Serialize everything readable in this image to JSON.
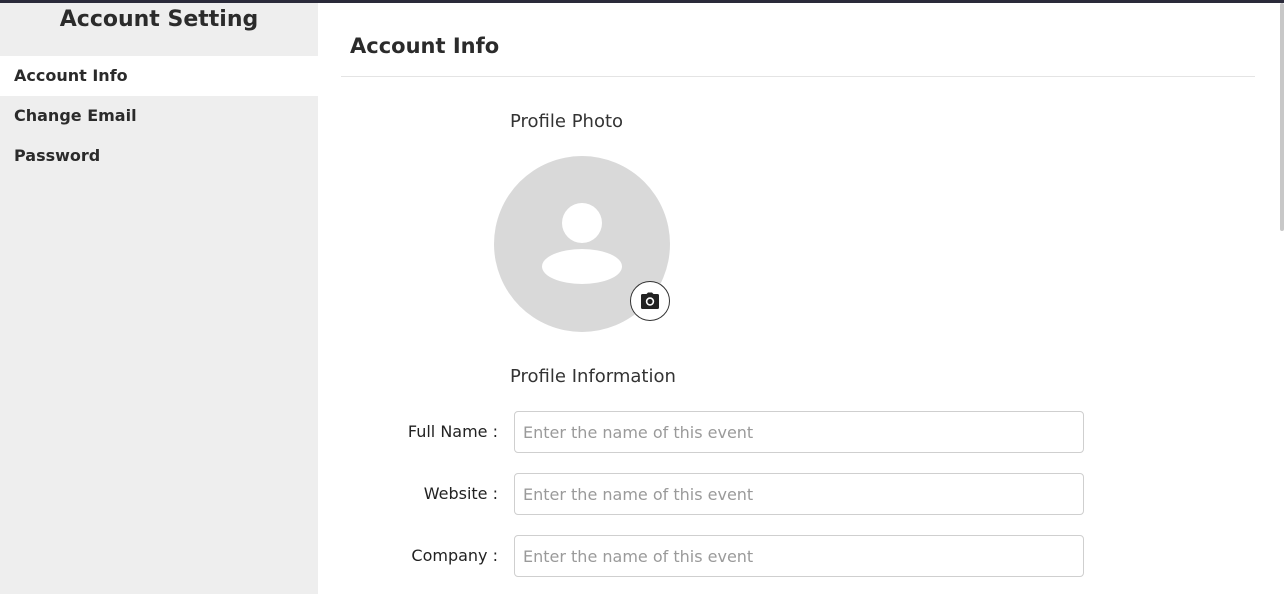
{
  "sidebar": {
    "title": "Account Setting",
    "items": [
      {
        "label": "Account Info",
        "active": true
      },
      {
        "label": "Change Email",
        "active": false
      },
      {
        "label": "Password",
        "active": false
      }
    ]
  },
  "main": {
    "title": "Account Info",
    "profile_photo_label": "Profile Photo",
    "profile_info_label": "Profile Information",
    "fields": [
      {
        "label": "Full Name :",
        "placeholder": "Enter the name of this event"
      },
      {
        "label": "Website :",
        "placeholder": "Enter the name of this event"
      },
      {
        "label": "Company :",
        "placeholder": "Enter the name of this event"
      }
    ]
  },
  "icons": {
    "avatar": "user-placeholder-icon",
    "camera": "camera-icon"
  }
}
